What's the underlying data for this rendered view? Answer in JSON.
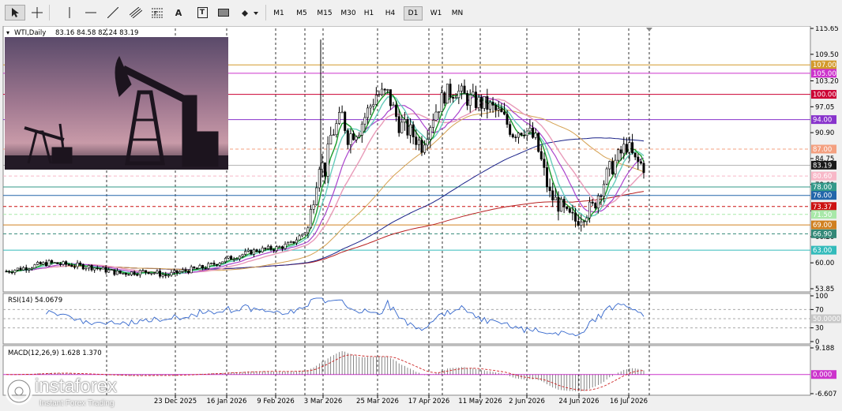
{
  "toolbar": {
    "tools": [
      {
        "name": "cursor-tool-icon"
      },
      {
        "name": "crosshair-tool-icon"
      },
      {
        "name": "vertical-line-tool-icon"
      },
      {
        "name": "horizontal-line-tool-icon"
      },
      {
        "name": "trendline-tool-icon"
      },
      {
        "name": "equidistant-channel-tool-icon"
      },
      {
        "name": "fibonacci-tool-icon"
      },
      {
        "name": "text-tool-icon",
        "label": "A"
      },
      {
        "name": "text-label-tool-icon",
        "label": "T"
      },
      {
        "name": "rectangle-label-tool-icon"
      },
      {
        "name": "arrow-shapes-tool-icon"
      }
    ],
    "timeframes": [
      "M1",
      "M5",
      "M15",
      "M30",
      "H1",
      "H4",
      "D1",
      "W1",
      "MN"
    ],
    "active_timeframe": "D1"
  },
  "chart": {
    "symbol_title": "WTI,Daily",
    "ohlc": "83.16 84.58 82.24 83.19",
    "price_axis_labels": [
      "115.65",
      "109.50",
      "103.20",
      "97.05",
      "90.90",
      "84.75",
      "78.60",
      "72.35",
      "66.20",
      "60.00",
      "53.85"
    ],
    "level_labels": [
      {
        "value": "107.00",
        "bg": "#d39a2c",
        "fg": "#ffffff",
        "price": 107.0
      },
      {
        "value": "105.00",
        "bg": "#cc33cc",
        "fg": "#ffffff",
        "price": 105.0
      },
      {
        "value": "100.00",
        "bg": "#cc0033",
        "fg": "#ffffff",
        "price": 100.0
      },
      {
        "value": "94.00",
        "bg": "#8833cc",
        "fg": "#ffffff",
        "price": 94.0
      },
      {
        "value": "87.00",
        "bg": "#f4a080",
        "fg": "#ffffff",
        "price": 87.0
      },
      {
        "value": "83.19",
        "bg": "#1a1a1a",
        "fg": "#ffffff",
        "price": 83.19
      },
      {
        "value": "80.60",
        "bg": "#f8b8c8",
        "fg": "#ffffff",
        "price": 80.6
      },
      {
        "value": "78.00",
        "bg": "#33998a",
        "fg": "#ffffff",
        "price": 78.0
      },
      {
        "value": "76.00",
        "bg": "#2266aa",
        "fg": "#ffffff",
        "price": 76.0
      },
      {
        "value": "73.37",
        "bg": "#cc1111",
        "fg": "#ffffff",
        "price": 73.37
      },
      {
        "value": "71.50",
        "bg": "#a8e8a8",
        "fg": "#ffffff",
        "price": 71.5
      },
      {
        "value": "69.00",
        "bg": "#d08020",
        "fg": "#ffffff",
        "price": 69.0
      },
      {
        "value": "66.90",
        "bg": "#338877",
        "fg": "#ffffff",
        "price": 66.9
      },
      {
        "value": "63.00",
        "bg": "#33bbbb",
        "fg": "#ffffff",
        "price": 63.0
      }
    ],
    "date_labels": [
      "23 Dec 2025",
      "16 Jan 2026",
      "9 Feb 2026",
      "3 Mar 2026",
      "25 Mar 2026",
      "17 Apr 2026",
      "11 May 2026",
      "2 Jun 2026",
      "24 Jun 2026",
      "16 Jul 2026"
    ]
  },
  "rsi": {
    "title": "RSI(14) 54.0679",
    "axis": [
      "100",
      "70",
      "30",
      "0"
    ],
    "level_label": "50.0000"
  },
  "macd": {
    "title": "MACD(12,26,9) 1.628 1.370",
    "axis": [
      "9.188",
      "-6.607"
    ],
    "zero_label": "0.000"
  },
  "watermark": {
    "brand": "instaforex",
    "tagline": "Instant Forex Trading"
  },
  "colors": {
    "background": "#ffffff",
    "candle": "#000000",
    "accent_purple": "#cc33cc",
    "ma_green": "#1a9a2a",
    "ma_cyan": "#66ccbb",
    "ma_pink": "#e89ab8",
    "ma_purple": "#aa44cc",
    "ma_orange": "#d4a050",
    "ma_navy": "#1a2288",
    "ma_red": "#b82020",
    "rsi_line": "#3366cc",
    "macd_hist": "#555555",
    "macd_signal": "#cc2222"
  }
}
